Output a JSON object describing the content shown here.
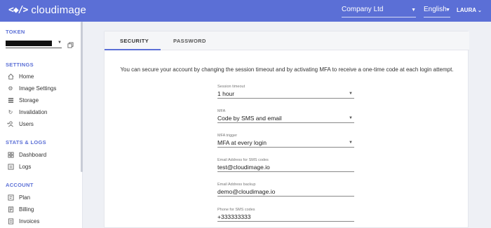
{
  "topbar": {
    "logo_mark": "<◆/>",
    "logo_text": "cloudimage",
    "company": "Company Ltd",
    "language": "English",
    "user": "LAURA"
  },
  "sidebar": {
    "token_title": "TOKEN",
    "settings_title": "SETTINGS",
    "settings_items": [
      "Home",
      "Image Settings",
      "Storage",
      "Invalidation",
      "Users"
    ],
    "stats_title": "STATS & LOGS",
    "stats_items": [
      "Dashboard",
      "Logs"
    ],
    "account_title": "ACCOUNT",
    "account_items": [
      "Plan",
      "Billing",
      "Invoices"
    ]
  },
  "tabs": {
    "security": "SECURITY",
    "password": "PASSWORD"
  },
  "intro": "You can secure your account by changing the session timeout and by activating MFA to receive a one-time code at each login attempt.",
  "fields": [
    {
      "label": "Session timeout",
      "value": "1 hour"
    },
    {
      "label": "MFA",
      "value": "Code by SMS and email"
    },
    {
      "label": "MFA trigger",
      "value": "MFA at every login"
    },
    {
      "label": "Email Address for SMS codes",
      "value": "test@cloudimage.io"
    },
    {
      "label": "Email Address backup",
      "value": "demo@cloudimage.io"
    },
    {
      "label": "Phone for SMS codes",
      "value": "+333333333"
    }
  ],
  "colors": {
    "accent": "#5b6fd6",
    "background": "#eef0f5"
  }
}
